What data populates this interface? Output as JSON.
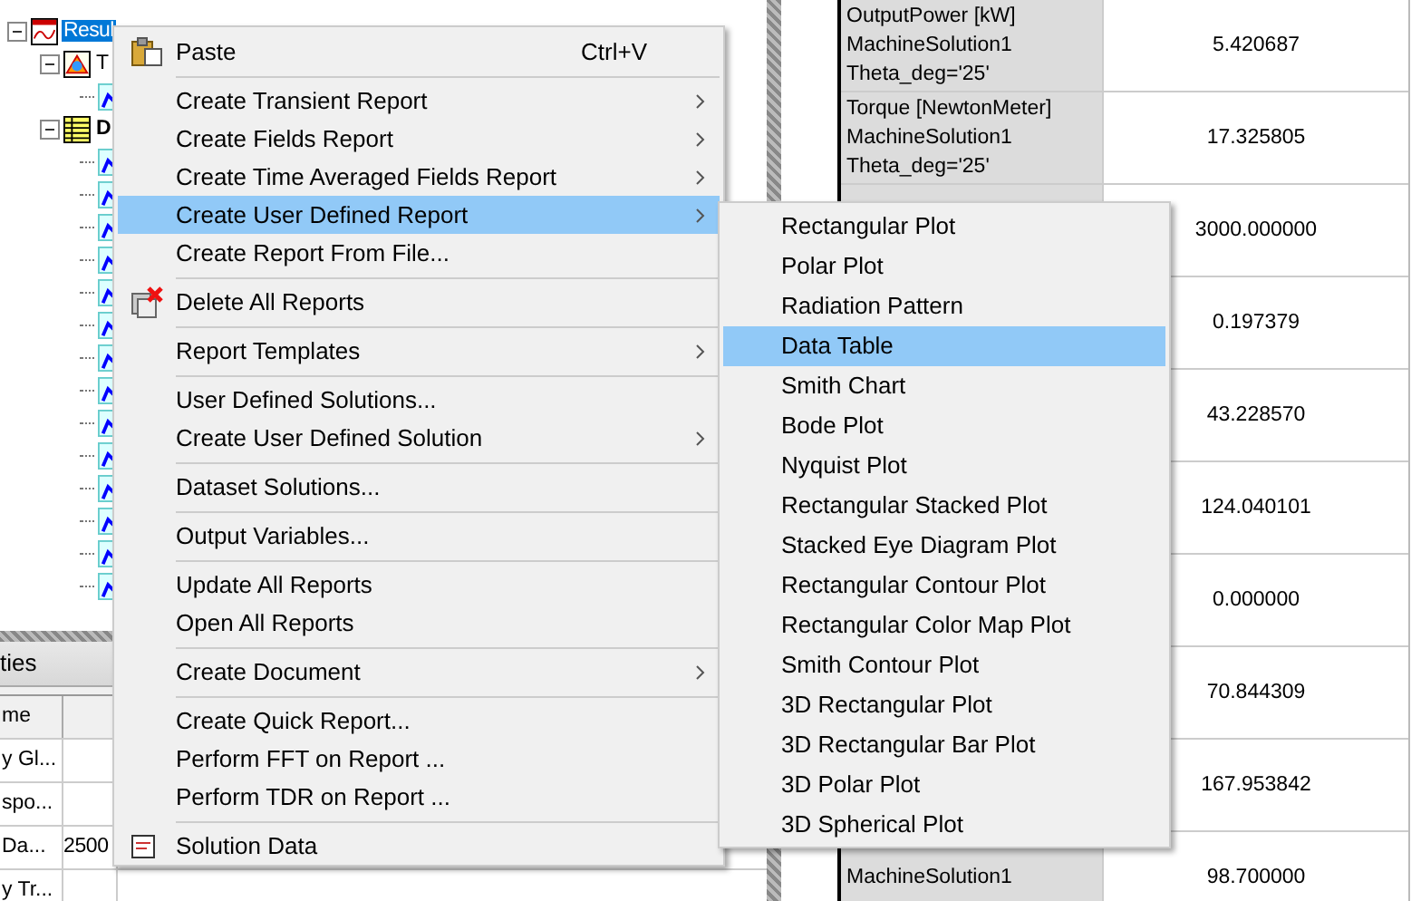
{
  "tree": {
    "label": "Resul",
    "selected": true,
    "expanded": true,
    "children": [
      {
        "label": "T",
        "kind": "folder",
        "expanded": true,
        "children": [
          {
            "kind": "plot"
          }
        ]
      },
      {
        "label": "D",
        "kind": "table",
        "expanded": true,
        "children": [
          {
            "kind": "plot"
          },
          {
            "kind": "plot"
          },
          {
            "kind": "plot"
          },
          {
            "kind": "plot"
          },
          {
            "kind": "plot"
          },
          {
            "kind": "plot"
          },
          {
            "kind": "plot"
          },
          {
            "kind": "plot"
          },
          {
            "kind": "plot"
          },
          {
            "kind": "plot"
          },
          {
            "kind": "plot"
          },
          {
            "kind": "plot"
          },
          {
            "kind": "plot"
          },
          {
            "kind": "plot"
          }
        ]
      }
    ]
  },
  "properties": {
    "title": "ties",
    "columns": [
      "me"
    ],
    "rows": [
      {
        "name": "y Gl..."
      },
      {
        "name": "spo..."
      },
      {
        "name": "Da...",
        "value": "2500"
      },
      {
        "name": "y Tr..."
      }
    ]
  },
  "data_table": {
    "rows": [
      {
        "lines": [
          "OutputPower [kW]",
          "MachineSolution1",
          "Theta_deg='25'"
        ],
        "value": "5.420687"
      },
      {
        "lines": [
          "Torque [NewtonMeter]",
          "MachineSolution1",
          "Theta_deg='25'"
        ],
        "value": "17.325805"
      },
      {
        "lines": [],
        "value": "3000.000000"
      },
      {
        "lines": [],
        "value": "0.197379"
      },
      {
        "lines": [],
        "value": "43.228570"
      },
      {
        "lines": [],
        "value": "124.040101"
      },
      {
        "lines": [],
        "value": "0.000000"
      },
      {
        "lines": [],
        "value": "70.844309"
      },
      {
        "lines": [],
        "value": "167.953842"
      },
      {
        "lines": [
          "MachineSolution1"
        ],
        "value": "98.700000"
      }
    ]
  },
  "context_menu": {
    "items": [
      {
        "kind": "paste",
        "label": "Paste",
        "shortcut": "Ctrl+V",
        "submenu": false,
        "selected": false
      },
      {
        "kind": "separator"
      },
      {
        "kind": "item",
        "label": "Create Transient Report",
        "submenu": true,
        "selected": false
      },
      {
        "kind": "item",
        "label": "Create Fields Report",
        "submenu": true,
        "selected": false
      },
      {
        "kind": "item",
        "label": "Create Time Averaged Fields Report",
        "submenu": true,
        "selected": false
      },
      {
        "kind": "item",
        "label": "Create User Defined Report",
        "submenu": true,
        "selected": true
      },
      {
        "kind": "item",
        "label": "Create Report From File...",
        "submenu": false,
        "selected": false
      },
      {
        "kind": "separator"
      },
      {
        "kind": "delete",
        "label": "Delete All Reports",
        "submenu": false,
        "selected": false
      },
      {
        "kind": "separator"
      },
      {
        "kind": "item",
        "label": "Report Templates",
        "submenu": true,
        "selected": false
      },
      {
        "kind": "separator"
      },
      {
        "kind": "item",
        "label": "User Defined Solutions...",
        "submenu": false,
        "selected": false
      },
      {
        "kind": "item",
        "label": "Create User Defined Solution",
        "submenu": true,
        "selected": false
      },
      {
        "kind": "separator"
      },
      {
        "kind": "item",
        "label": "Dataset Solutions...",
        "submenu": false,
        "selected": false
      },
      {
        "kind": "separator"
      },
      {
        "kind": "item",
        "label": "Output Variables...",
        "submenu": false,
        "selected": false
      },
      {
        "kind": "separator"
      },
      {
        "kind": "item",
        "label": "Update All Reports",
        "submenu": false,
        "selected": false
      },
      {
        "kind": "item",
        "label": "Open All Reports",
        "submenu": false,
        "selected": false
      },
      {
        "kind": "separator"
      },
      {
        "kind": "item",
        "label": "Create Document",
        "submenu": true,
        "selected": false
      },
      {
        "kind": "separator"
      },
      {
        "kind": "item",
        "label": "Create Quick Report...",
        "submenu": false,
        "selected": false
      },
      {
        "kind": "item",
        "label": "Perform FFT on Report ...",
        "submenu": false,
        "selected": false
      },
      {
        "kind": "item",
        "label": "Perform TDR on Report ...",
        "submenu": false,
        "selected": false
      },
      {
        "kind": "separator"
      },
      {
        "kind": "solution",
        "label": "Solution Data",
        "submenu": false,
        "selected": false
      }
    ]
  },
  "submenu": {
    "items": [
      {
        "label": "Rectangular Plot",
        "selected": false
      },
      {
        "label": "Polar Plot",
        "selected": false
      },
      {
        "label": "Radiation Pattern",
        "selected": false
      },
      {
        "label": "Data Table",
        "selected": true
      },
      {
        "label": "Smith Chart",
        "selected": false
      },
      {
        "label": "Bode Plot",
        "selected": false
      },
      {
        "label": "Nyquist Plot",
        "selected": false
      },
      {
        "label": "Rectangular Stacked Plot",
        "selected": false
      },
      {
        "label": "Stacked Eye Diagram Plot",
        "selected": false
      },
      {
        "label": "Rectangular Contour Plot",
        "selected": false
      },
      {
        "label": "Rectangular Color Map Plot",
        "selected": false
      },
      {
        "label": "Smith Contour Plot",
        "selected": false
      },
      {
        "label": "3D Rectangular Plot",
        "selected": false
      },
      {
        "label": "3D Rectangular Bar Plot",
        "selected": false
      },
      {
        "label": "3D Polar Plot",
        "selected": false
      },
      {
        "label": "3D Spherical Plot",
        "selected": false
      }
    ]
  }
}
